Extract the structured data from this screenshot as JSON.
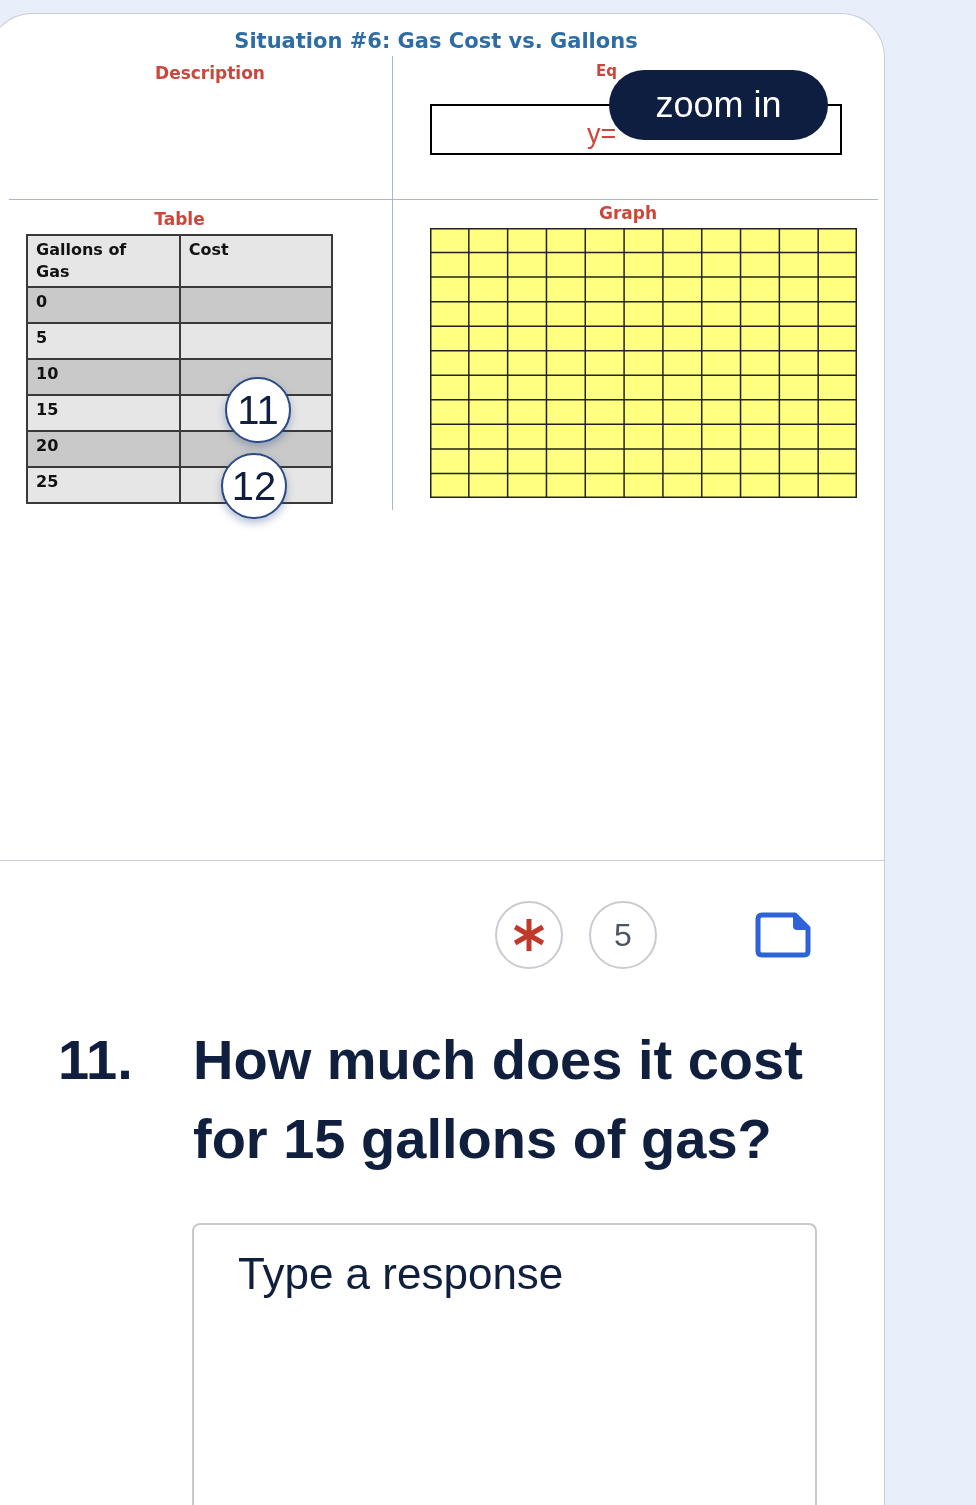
{
  "worksheet": {
    "title": "Situation #6: Gas Cost vs. Gallons",
    "description_label": "Description",
    "equation_label": "Eq",
    "equation": "y=",
    "table_label": "Table",
    "table": {
      "columns": [
        "Gallons of Gas",
        "Cost"
      ],
      "rows": [
        {
          "gallons": "0"
        },
        {
          "gallons": "5"
        },
        {
          "gallons": "10"
        },
        {
          "gallons": "15"
        },
        {
          "gallons": "20"
        },
        {
          "gallons": "25"
        }
      ]
    },
    "graph_label": "Graph"
  },
  "zoom_button": {
    "label": "zoom in"
  },
  "markers": [
    {
      "label": "11"
    },
    {
      "label": "12"
    }
  ],
  "question": {
    "required": true,
    "points": "5",
    "number": "11.",
    "text": "How much does it cost for 15 gallons of gas?",
    "response": {
      "placeholder": "Type a response"
    }
  }
}
